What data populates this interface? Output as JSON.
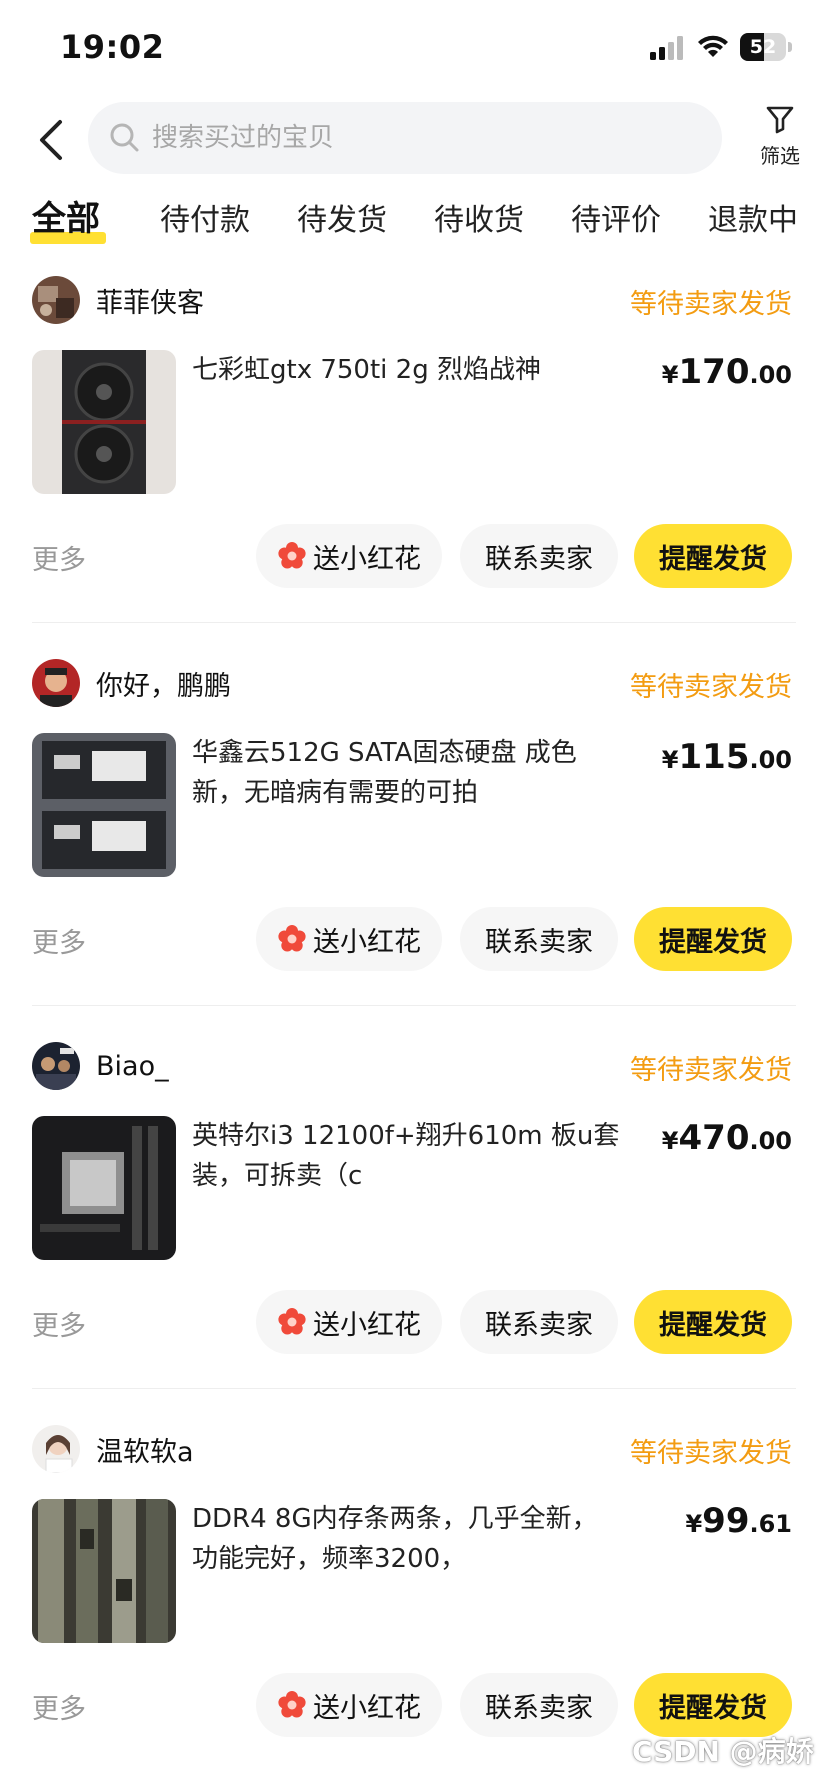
{
  "status_bar": {
    "time": "19:02",
    "battery": "52",
    "battery_level": 52
  },
  "header": {
    "search_placeholder": "搜索买过的宝贝",
    "filter_label": "筛选"
  },
  "tabs": [
    {
      "label": "全部",
      "active": true
    },
    {
      "label": "待付款",
      "active": false
    },
    {
      "label": "待发货",
      "active": false
    },
    {
      "label": "待收货",
      "active": false
    },
    {
      "label": "待评价",
      "active": false
    },
    {
      "label": "退款中",
      "active": false
    }
  ],
  "orders": [
    {
      "seller": "菲菲侠客",
      "status": "等待卖家发货",
      "title": "七彩虹gtx 750ti 2g 烈焰战神",
      "price_symbol": "¥",
      "price_int": "170",
      "price_dec": ".00",
      "more": "更多",
      "btn_flower": "送小红花",
      "btn_contact": "联系卖家",
      "btn_remind": "提醒发货"
    },
    {
      "seller": "你好，鹏鹏",
      "status": "等待卖家发货",
      "title": "华鑫云512G SATA固态硬盘 成色新，无暗病有需要的可拍",
      "price_symbol": "¥",
      "price_int": "115",
      "price_dec": ".00",
      "more": "更多",
      "btn_flower": "送小红花",
      "btn_contact": "联系卖家",
      "btn_remind": "提醒发货"
    },
    {
      "seller": "Biao_",
      "status": "等待卖家发货",
      "title": "英特尔i3 12100f+翔升610m 板u套装，可拆卖（c",
      "price_symbol": "¥",
      "price_int": "470",
      "price_dec": ".00",
      "more": "更多",
      "btn_flower": "送小红花",
      "btn_contact": "联系卖家",
      "btn_remind": "提醒发货"
    },
    {
      "seller": "温软软a",
      "status": "等待卖家发货",
      "title": "DDR4 8G内存条两条，几乎全新，功能完好，频率3200，",
      "price_symbol": "¥",
      "price_int": "99",
      "price_dec": ".61",
      "more": "更多",
      "btn_flower": "送小红花",
      "btn_contact": "联系卖家",
      "btn_remind": "提醒发货"
    }
  ],
  "watermark": "CSDN @病娇",
  "colors": {
    "accent": "#ffe033",
    "status": "#f39c12",
    "muted": "#999999"
  }
}
